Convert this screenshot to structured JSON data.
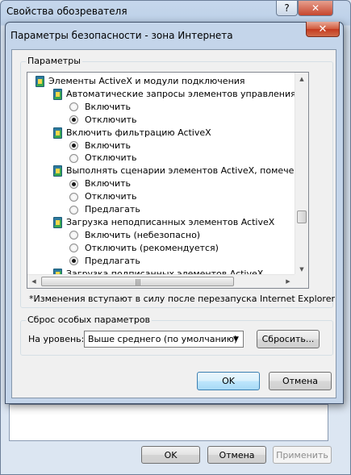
{
  "bg_window": {
    "title": "Свойства обозревателя",
    "help_glyph": "?",
    "close_glyph": "✕",
    "buttons": {
      "ok": "OK",
      "cancel": "Отмена",
      "apply": "Применить"
    }
  },
  "dialog": {
    "title": "Параметры безопасности - зона Интернета",
    "close_glyph": "✕",
    "settings_group_label": "Параметры",
    "tree": [
      {
        "type": "category",
        "label": "Элементы ActiveX и модули подключения"
      },
      {
        "type": "item",
        "label": "Автоматические запросы элементов управления ActiveX"
      },
      {
        "type": "option",
        "label": "Включить",
        "selected": false
      },
      {
        "type": "option",
        "label": "Отключить",
        "selected": true
      },
      {
        "type": "item",
        "label": "Включить фильтрацию ActiveX"
      },
      {
        "type": "option",
        "label": "Включить",
        "selected": true
      },
      {
        "type": "option",
        "label": "Отключить",
        "selected": false
      },
      {
        "type": "item",
        "label": "Выполнять сценарии элементов ActiveX, помеченные как"
      },
      {
        "type": "option",
        "label": "Включить",
        "selected": true
      },
      {
        "type": "option",
        "label": "Отключить",
        "selected": false
      },
      {
        "type": "option",
        "label": "Предлагать",
        "selected": false
      },
      {
        "type": "item",
        "label": "Загрузка неподписанных элементов ActiveX"
      },
      {
        "type": "option",
        "label": "Включить (небезопасно)",
        "selected": false
      },
      {
        "type": "option",
        "label": "Отключить (рекомендуется)",
        "selected": false
      },
      {
        "type": "option",
        "label": "Предлагать",
        "selected": true
      },
      {
        "type": "item",
        "label": "Загрузка подписанных элементов ActiveX"
      }
    ],
    "restart_note": "*Изменения вступают в силу после перезапуска Internet Explorer",
    "reset_group_label": "Сброс особых параметров",
    "level_label": "На уровень:",
    "level_value": "Выше среднего (по умолчанию)",
    "reset_button": "Сбросить...",
    "ok_button": "OK",
    "cancel_button": "Отмена"
  }
}
